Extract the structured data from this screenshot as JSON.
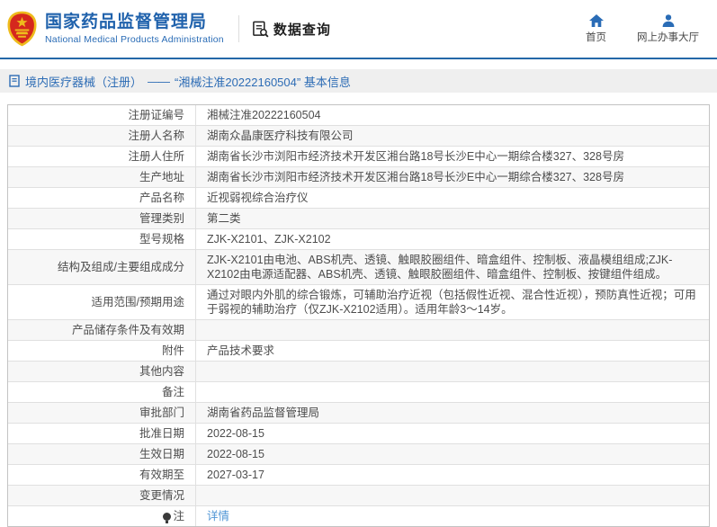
{
  "header": {
    "logo_icon": "national-emblem-icon",
    "site_title": "国家药品监督管理局",
    "site_subtitle": "National Medical Products Administration",
    "section": {
      "icon": "data-query-icon",
      "label": "数据查询"
    },
    "nav": [
      {
        "icon": "home-icon",
        "label": "首页"
      },
      {
        "icon": "person-icon",
        "label": "网上办事大厅"
      }
    ]
  },
  "breadcrumb": {
    "icon": "document-icon",
    "section": "境内医疗器械（注册）",
    "separator": "——",
    "current": "“湘械注准20222160504” 基本信息"
  },
  "info_table": {
    "rows": [
      {
        "label": "注册证编号",
        "value": "湘械注准20222160504"
      },
      {
        "label": "注册人名称",
        "value": "湖南众晶康医疗科技有限公司"
      },
      {
        "label": "注册人住所",
        "value": "湖南省长沙市浏阳市经济技术开发区湘台路18号长沙E中心一期综合楼327、328号房"
      },
      {
        "label": "生产地址",
        "value": "湖南省长沙市浏阳市经济技术开发区湘台路18号长沙E中心一期综合楼327、328号房"
      },
      {
        "label": "产品名称",
        "value": "近视弱视综合治疗仪"
      },
      {
        "label": "管理类别",
        "value": "第二类"
      },
      {
        "label": "型号规格",
        "value": "ZJK-X2101、ZJK-X2102"
      },
      {
        "label": "结构及组成/主要组成成分",
        "value": "ZJK-X2101由电池、ABS机壳、透镜、触眼胶圈组件、暗盒组件、控制板、液晶模组组成;ZJK-X2102由电源适配器、ABS机壳、透镜、触眼胶圈组件、暗盒组件、控制板、按键组件组成。"
      },
      {
        "label": "适用范围/预期用途",
        "value": "通过对眼内外肌的综合锻炼，可辅助治疗近视（包括假性近视、混合性近视），预防真性近视；可用于弱视的辅助治疗（仅ZJK-X2102适用）。适用年龄3～14岁。"
      },
      {
        "label": "产品储存条件及有效期",
        "value": ""
      },
      {
        "label": "附件",
        "value": "产品技术要求"
      },
      {
        "label": "其他内容",
        "value": ""
      },
      {
        "label": "备注",
        "value": ""
      },
      {
        "label": "审批部门",
        "value": "湖南省药品监督管理局"
      },
      {
        "label": "批准日期",
        "value": "2022-08-15"
      },
      {
        "label": "生效日期",
        "value": "2022-08-15"
      },
      {
        "label": "有效期至",
        "value": "2027-03-17"
      },
      {
        "label": "变更情况",
        "value": ""
      },
      {
        "label": "注",
        "label_icon": "bulb-icon",
        "value": "详情",
        "value_type": "link"
      }
    ]
  },
  "colors": {
    "brand_blue": "#2062ac",
    "header_line_blue": "#2468a8",
    "nav_icon_blue": "#2a6cb6",
    "breadcrumb_text_blue": "#2d6cb5",
    "link_blue": "#4f95d5",
    "breadcrumb_bg": "#efefef",
    "row_alt_bg": "#f7f7f7",
    "table_border": "#c3c3c3",
    "emblem_red": "#d5281e",
    "emblem_gold": "#eebb1c"
  }
}
